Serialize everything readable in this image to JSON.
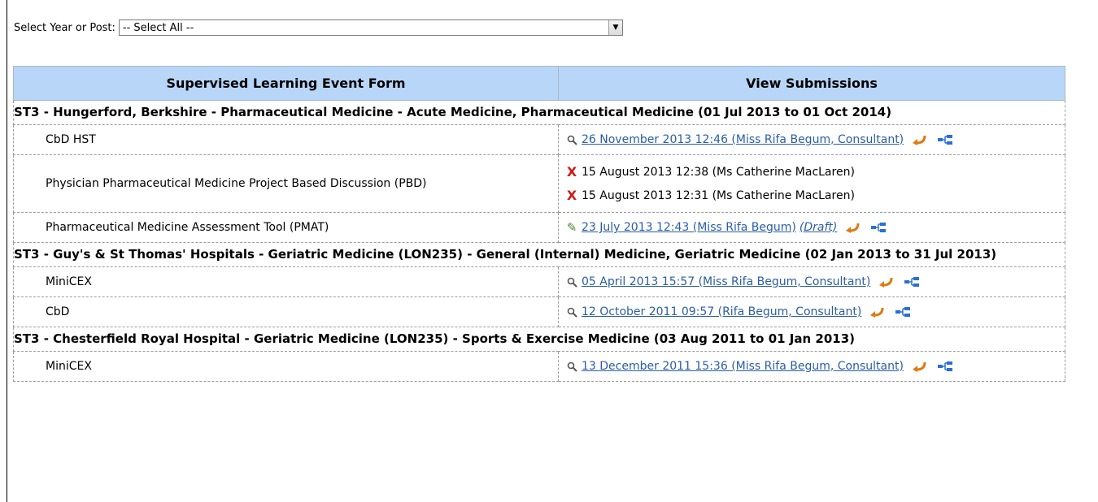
{
  "filter": {
    "label": "Select Year or Post:",
    "selected": "-- Select All --"
  },
  "table": {
    "headers": [
      "Supervised Learning Event Form",
      "View Submissions"
    ]
  },
  "sections": [
    {
      "title": "ST3 - Hungerford, Berkshire - Pharmaceutical Medicine - Acute Medicine, Pharmaceutical Medicine (01 Jul 2013 to 01 Oct 2014)",
      "rows": [
        {
          "form": "CbD HST",
          "submissions": [
            {
              "text": "26 November 2013 12:46 (Miss Rifa Begum, Consultant)",
              "status": "view",
              "link": true
            }
          ]
        },
        {
          "form": "Physician Pharmaceutical Medicine Project Based Discussion (PBD)",
          "submissions": [
            {
              "text": "15 August 2013 12:38 (Ms Catherine MacLaren)",
              "status": "rejected",
              "link": false
            },
            {
              "text": "15 August 2013 12:31 (Ms Catherine MacLaren)",
              "status": "rejected",
              "link": false
            }
          ]
        },
        {
          "form": "Pharmaceutical Medicine Assessment Tool (PMAT)",
          "submissions": [
            {
              "text": "23 July 2013 12:43 (Miss Rifa Begum)",
              "draft": "(Draft)",
              "status": "draft",
              "link": true
            }
          ]
        }
      ]
    },
    {
      "title": "ST3 - Guy's & St Thomas' Hospitals - Geriatric Medicine (LON235) - General (Internal) Medicine, Geriatric Medicine (02 Jan 2013 to 31 Jul 2013)",
      "rows": [
        {
          "form": "MiniCEX",
          "submissions": [
            {
              "text": "05 April 2013 15:57 (Miss Rifa Begum, Consultant)",
              "status": "view",
              "link": true
            }
          ]
        },
        {
          "form": "CbD",
          "submissions": [
            {
              "text": "12 October 2011 09:57 (Rifa Begum, Consultant)",
              "status": "view",
              "link": true
            }
          ]
        }
      ]
    },
    {
      "title": "ST3 - Chesterfield Royal Hospital - Geriatric Medicine (LON235) - Sports & Exercise Medicine (03 Aug 2011 to 01 Jan 2013)",
      "rows": [
        {
          "form": "MiniCEX",
          "submissions": [
            {
              "text": "13 December 2011 15:36 (Miss Rifa Begum, Consultant)",
              "status": "view",
              "link": true
            }
          ]
        }
      ]
    }
  ],
  "icons": {
    "view": "magnifier-icon",
    "rejected": "x-icon",
    "draft": "check-pencil-icon",
    "return": "return-arrow-icon",
    "tree": "tree-icon"
  },
  "colors": {
    "header_bg": "#b8d6f8",
    "link": "#2a5da8",
    "reject": "#d01818",
    "return_arrow": "#e07a10"
  }
}
